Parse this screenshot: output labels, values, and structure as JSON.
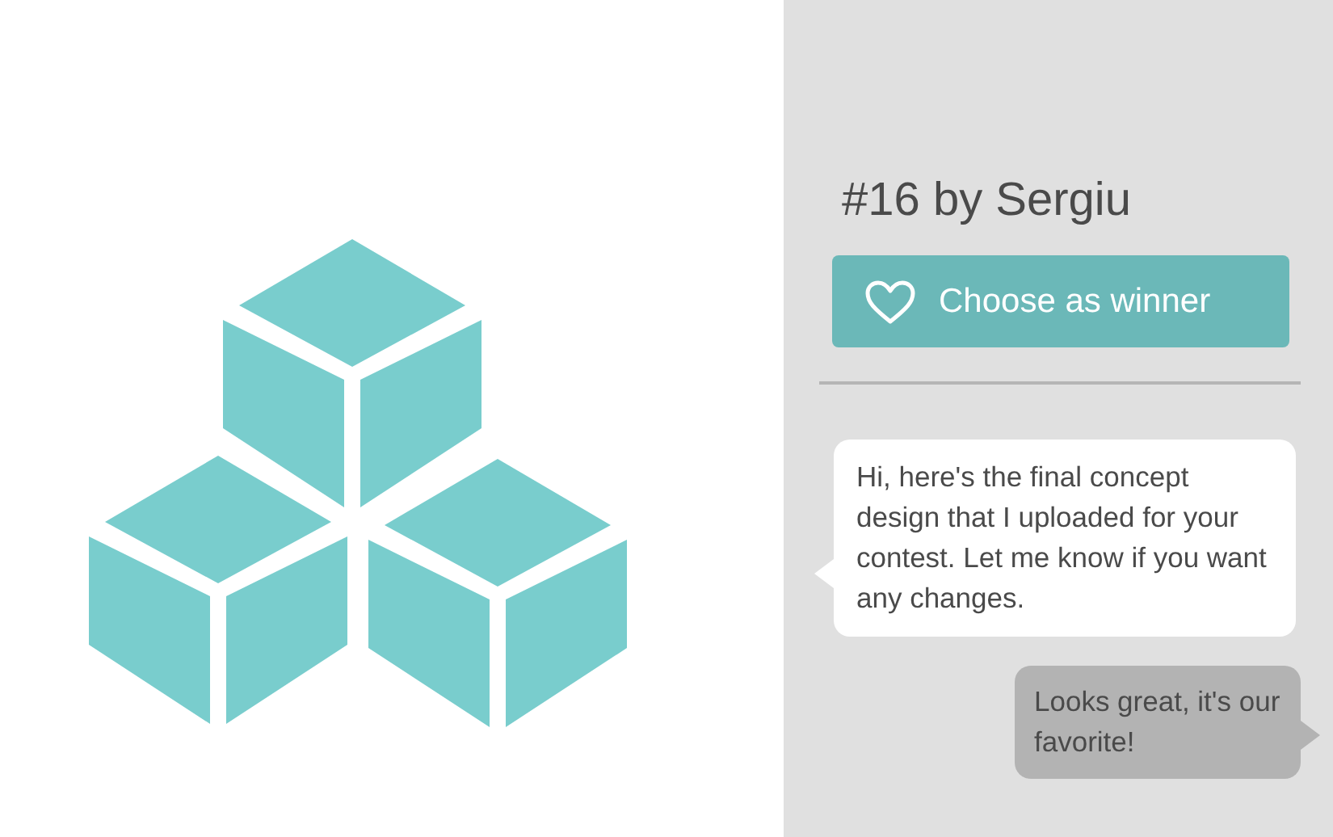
{
  "entry": {
    "title": "#16 by Sergiu"
  },
  "winner_button": {
    "label": "Choose as winner"
  },
  "messages": [
    {
      "kind": "received",
      "text": "Hi, here's the final concept design that I uploaded for your contest. Let me know if you want any changes."
    },
    {
      "kind": "sent",
      "text": "Looks great, it's our favorite!"
    }
  ]
}
